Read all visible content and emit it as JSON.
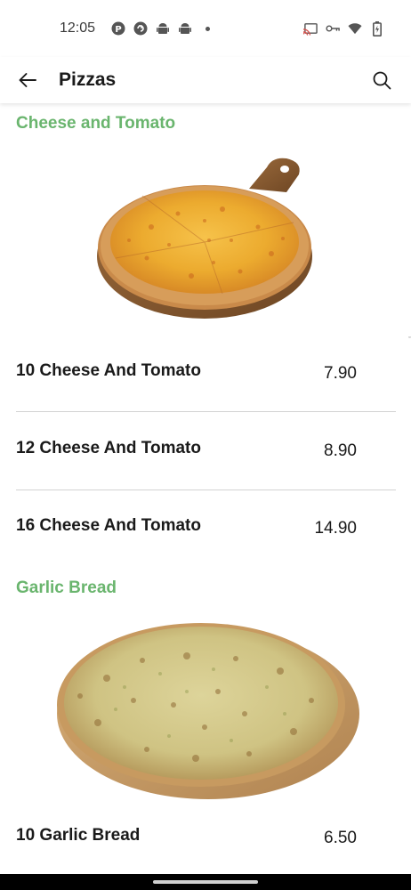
{
  "status_bar": {
    "time": "12:05",
    "left_icons": [
      "p-badge-icon",
      "sync-icon",
      "android-icon",
      "android-icon",
      "dot-icon"
    ],
    "right_icons": [
      "cast-icon",
      "vpn-key-icon",
      "wifi-icon",
      "battery-icon"
    ]
  },
  "app_bar": {
    "title": "Pizzas",
    "back_icon": "arrow-left-icon",
    "search_icon": "search-icon"
  },
  "categories": [
    {
      "title": "Cheese and Tomato",
      "image": "cheese-tomato-pizza-on-wooden-board",
      "items": [
        {
          "name": "10 Cheese And Tomato",
          "price": "7.90"
        },
        {
          "name": "12 Cheese And Tomato",
          "price": "8.90"
        },
        {
          "name": "16 Cheese And Tomato",
          "price": "14.90"
        }
      ]
    },
    {
      "title": "Garlic Bread",
      "image": "garlic-bread-on-wooden-board",
      "items": [
        {
          "name": "10 Garlic Bread",
          "price": "6.50"
        }
      ]
    }
  ],
  "colors": {
    "accent": "#6ab56e",
    "divider": "#d3d3d3",
    "text": "#1a1a1a"
  }
}
